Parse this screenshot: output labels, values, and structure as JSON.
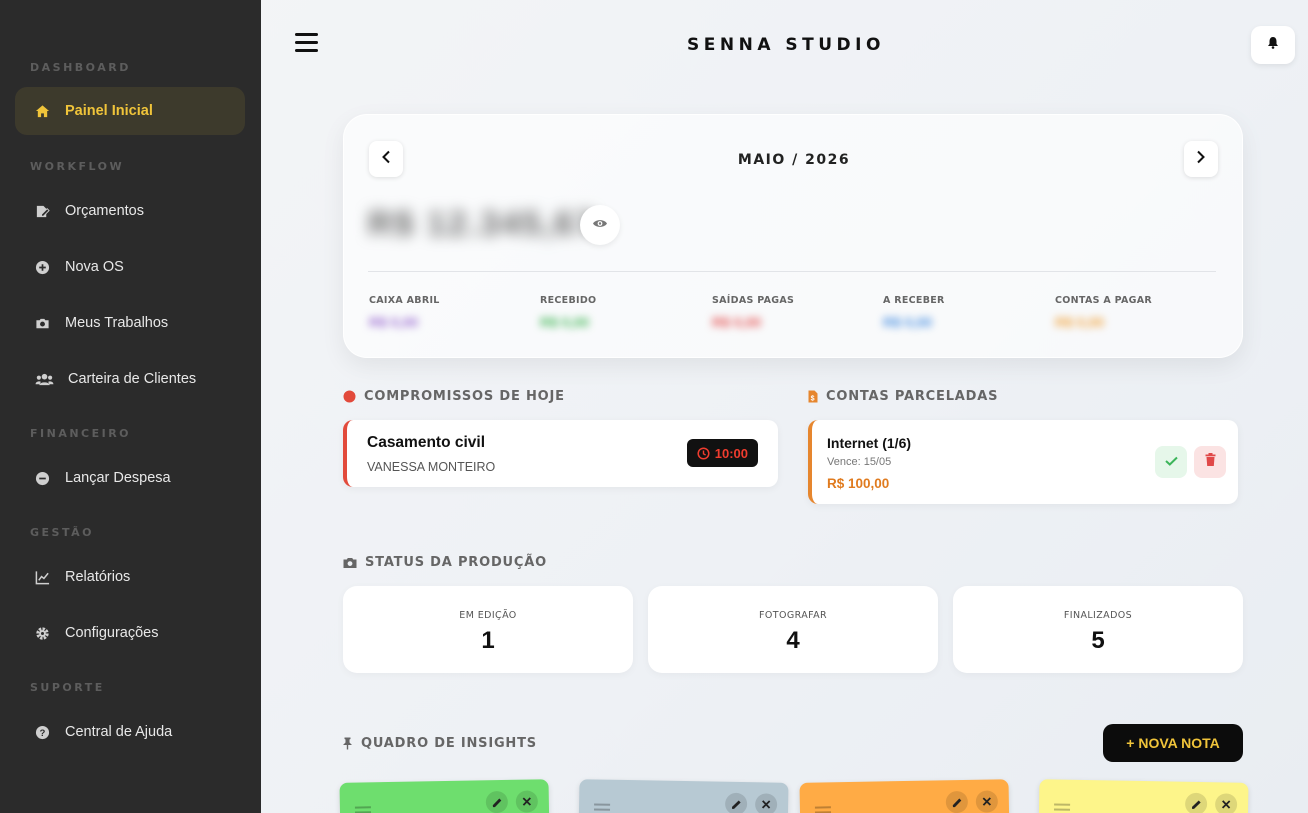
{
  "app": {
    "brand": "SENNA STUDIO"
  },
  "sidebar": {
    "sections": {
      "dashboard": "DASHBOARD",
      "workflow": "WORKFLOW",
      "financeiro": "FINANCEIRO",
      "gestao": "GESTÃO",
      "suporte": "SUPORTE"
    },
    "items": {
      "painel": "Painel Inicial",
      "orcamentos": "Orçamentos",
      "nova_os": "Nova OS",
      "trabalhos": "Meus Trabalhos",
      "clientes": "Carteira de Clientes",
      "despesa": "Lançar Despesa",
      "relatorios": "Relatórios",
      "config": "Configurações",
      "ajuda": "Central de Ajuda"
    }
  },
  "month": {
    "title": "MAIO / 2026",
    "balance": "R$ 12.345,67",
    "stats": {
      "caixa": {
        "label": "CAIXA ABRIL",
        "value": "R$ 0,00"
      },
      "recebido": {
        "label": "RECEBIDO",
        "value": "R$ 0,00"
      },
      "saidas": {
        "label": "SAÍDAS PAGAS",
        "value": "R$ 0,00"
      },
      "receber": {
        "label": "A RECEBER",
        "value": "R$ 0,00"
      },
      "pagar": {
        "label": "CONTAS A PAGAR",
        "value": "R$ 0,00"
      }
    }
  },
  "appointments": {
    "heading": "COMPROMISSOS DE HOJE",
    "item": {
      "title": "Casamento civil",
      "client": "VANESSA MONTEIRO",
      "time": "10:00"
    }
  },
  "installments": {
    "heading": "CONTAS PARCELADAS",
    "item": {
      "title": "Internet (1/6)",
      "due": "Vence: 15/05",
      "amount": "R$ 100,00"
    }
  },
  "production": {
    "heading": "STATUS DA PRODUÇÃO",
    "editing": {
      "label": "EM EDIÇÃO",
      "value": "1"
    },
    "shoot": {
      "label": "FOTOGRAFAR",
      "value": "4"
    },
    "done": {
      "label": "FINALIZADOS",
      "value": "5"
    }
  },
  "insights": {
    "heading": "QUADRO DE INSIGHTS",
    "new_note": "+ NOVA NOTA"
  },
  "colors": {
    "accent": "#f0c43a",
    "sidebar": "#2b2b2b",
    "appointment": "#e24a3b",
    "installment": "#e6862e",
    "notes": [
      "#6ede6e",
      "#b7c9d3",
      "#ffab45",
      "#fdf58a"
    ]
  }
}
